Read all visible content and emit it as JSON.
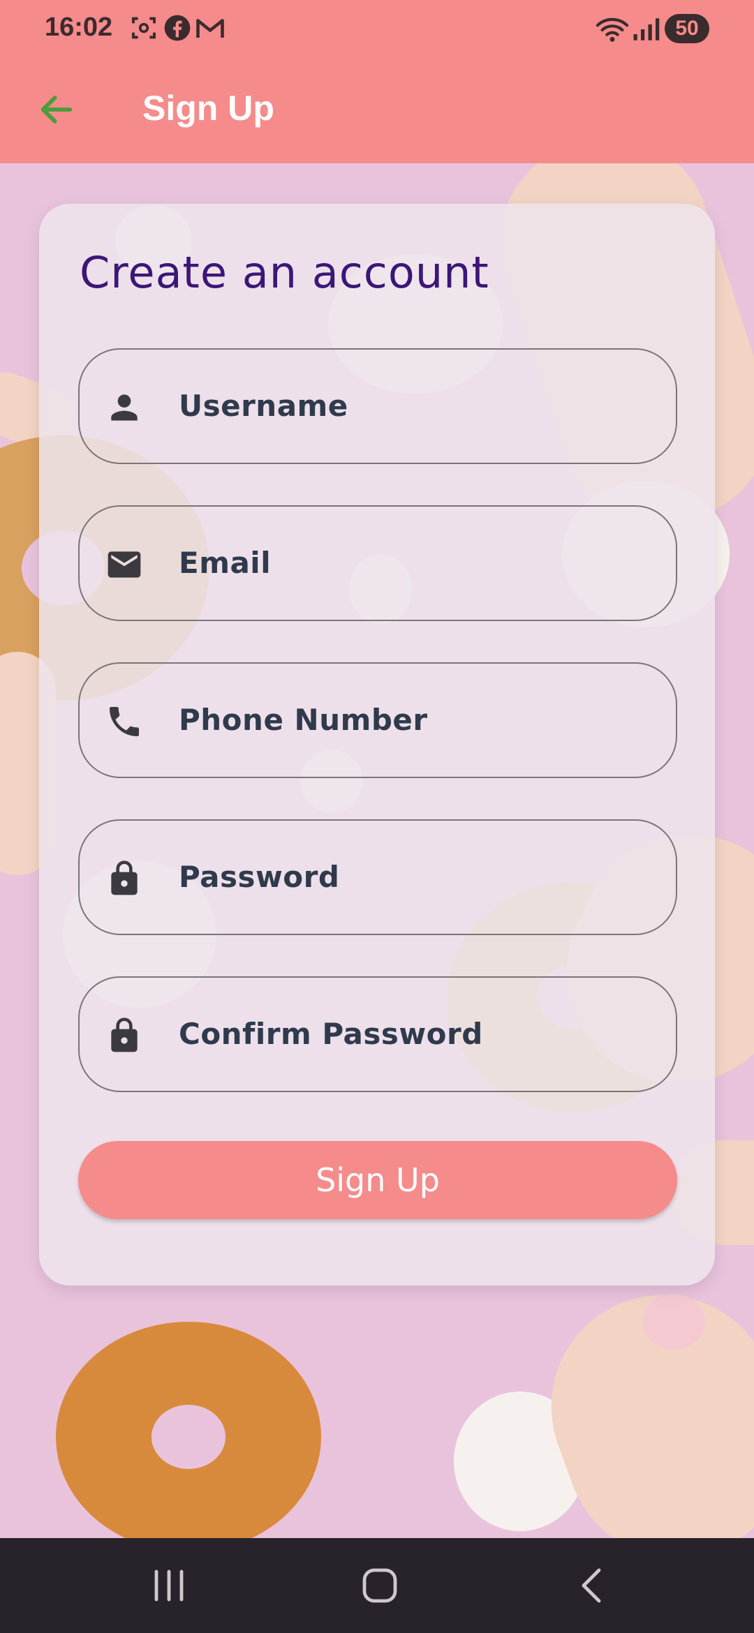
{
  "status_bar": {
    "time": "16:02",
    "battery": "50",
    "icons": [
      "screenshot-icon",
      "facebook-icon",
      "gmail-icon",
      "wifi-icon",
      "signal-icon"
    ]
  },
  "app_bar": {
    "title": "Sign Up",
    "back_icon": "arrow-back-icon"
  },
  "form": {
    "heading": "Create an account",
    "fields": [
      {
        "placeholder": "Username",
        "icon": "person-icon"
      },
      {
        "placeholder": "Email",
        "icon": "mail-icon"
      },
      {
        "placeholder": "Phone Number",
        "icon": "phone-icon"
      },
      {
        "placeholder": "Password",
        "icon": "lock-icon"
      },
      {
        "placeholder": "Confirm Password",
        "icon": "lock-icon"
      }
    ],
    "submit_label": "Sign Up"
  },
  "nav_bar": {
    "buttons": [
      "recent-apps-icon",
      "home-icon",
      "back-icon"
    ]
  },
  "colors": {
    "accent": "#f58b8b",
    "heading": "#3c1677",
    "field_text": "#2f3a4c",
    "background": "#e9c3dc"
  }
}
